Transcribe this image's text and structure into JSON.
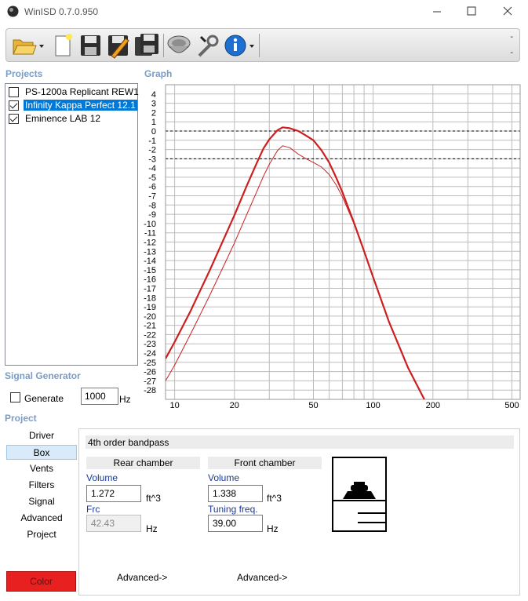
{
  "window": {
    "title": "WinISD 0.7.0.950",
    "icons": [
      "app-icon",
      "minimize-icon",
      "maximize-icon",
      "close-icon"
    ]
  },
  "toolbar": {
    "icons": [
      "open-folder-icon",
      "new-document-icon",
      "save-icon",
      "edit-icon",
      "save-all-icon",
      "driver-icon",
      "tools-icon",
      "info-icon"
    ],
    "dash_top": "-",
    "dash_bottom": "-"
  },
  "projects": {
    "label": "Projects",
    "items": [
      {
        "name": "PS-1200a Replicant REW1",
        "checked": false,
        "selected": false
      },
      {
        "name": "Infinity Kappa Perfect 12.1",
        "checked": true,
        "selected": true
      },
      {
        "name": "Eminence LAB 12",
        "checked": true,
        "selected": false
      }
    ]
  },
  "graph": {
    "label": "Graph"
  },
  "chart_data": {
    "type": "line",
    "x_scale": "log",
    "xlim": [
      9,
      550
    ],
    "ylim": [
      -29,
      5
    ],
    "x_ticks": [
      10,
      20,
      50,
      100,
      200,
      500
    ],
    "y_ticks": [
      4,
      3,
      2,
      1,
      0,
      -1,
      -2,
      -3,
      -4,
      -5,
      -6,
      -7,
      -8,
      -9,
      -10,
      -11,
      -12,
      -13,
      -14,
      -15,
      -16,
      -17,
      -18,
      -19,
      -20,
      -21,
      -22,
      -23,
      -24,
      -25,
      -26,
      -27,
      -28
    ],
    "reference_lines": [
      0,
      -3
    ],
    "grid": true,
    "series": [
      {
        "color": "#cc2020",
        "thick": true,
        "x": [
          9,
          10,
          12,
          15,
          18,
          20,
          23,
          26,
          28,
          30,
          33,
          35,
          38,
          42,
          46,
          50,
          55,
          60,
          65,
          70,
          80,
          90,
          100,
          120,
          150,
          180,
          200,
          230
        ],
        "y": [
          -24.6,
          -22.8,
          -19.5,
          -15.1,
          -11.3,
          -9.1,
          -6.0,
          -3.4,
          -1.9,
          -0.9,
          0.1,
          0.4,
          0.3,
          0.0,
          -0.5,
          -1.0,
          -2.1,
          -3.4,
          -5.0,
          -6.6,
          -9.9,
          -13.0,
          -15.8,
          -20.6,
          -25.6,
          -28.9,
          -30.5,
          -32.5
        ]
      },
      {
        "color": "#cc2020",
        "thick": false,
        "x": [
          9,
          10,
          12,
          15,
          18,
          20,
          23,
          26,
          28,
          30,
          33,
          35,
          38,
          42,
          46,
          50,
          55,
          60,
          65,
          70,
          80,
          90,
          100,
          120,
          150,
          180,
          200,
          230
        ],
        "y": [
          -27.0,
          -25.3,
          -22.0,
          -17.8,
          -14.2,
          -12.1,
          -9.1,
          -6.5,
          -4.9,
          -3.6,
          -2.1,
          -1.6,
          -1.8,
          -2.5,
          -3.0,
          -3.4,
          -3.9,
          -4.7,
          -5.8,
          -7.1,
          -10.0,
          -13.0,
          -15.8,
          -20.6,
          -25.6,
          -28.9,
          -30.5,
          -32.5
        ]
      }
    ]
  },
  "signal_generator": {
    "label": "Signal Generator",
    "generate_label": "Generate",
    "generate_checked": false,
    "frequency": "1000",
    "unit": "Hz"
  },
  "project_nav": {
    "label": "Project",
    "items": [
      "Driver",
      "Box",
      "Vents",
      "Filters",
      "Signal",
      "Advanced",
      "Project"
    ],
    "selected": "Box",
    "color_button": "Color",
    "color": "#e82020"
  },
  "box": {
    "type": "4th order bandpass",
    "rear": {
      "header": "Rear chamber",
      "volume_label": "Volume",
      "volume": "1.272",
      "volume_unit": "ft^3",
      "frc_label": "Frc",
      "frc": "42.43",
      "frc_unit": "Hz",
      "advanced": "Advanced->"
    },
    "front": {
      "header": "Front chamber",
      "volume_label": "Volume",
      "volume": "1.338",
      "volume_unit": "ft^3",
      "tuning_label": "Tuning freq.",
      "tuning": "39.00",
      "tuning_unit": "Hz",
      "advanced": "Advanced->"
    }
  }
}
